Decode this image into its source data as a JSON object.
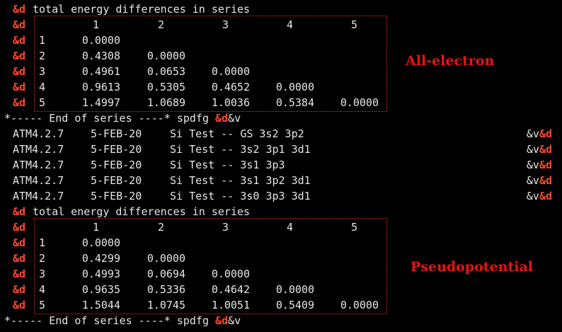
{
  "marker": "&d",
  "marker_v": "&v",
  "header_text": "total energy differences in series",
  "column_headers": [
    "1",
    "2",
    "3",
    "4",
    "5"
  ],
  "row_numbers": [
    "1",
    "2",
    "3",
    "4",
    "5"
  ],
  "all_electron": {
    "label": "All-electron",
    "rows": [
      [
        "0.0000"
      ],
      [
        "0.4308",
        "0.0000"
      ],
      [
        "0.4961",
        "0.0653",
        "0.0000"
      ],
      [
        "0.9613",
        "0.5305",
        "0.4652",
        "0.0000"
      ],
      [
        "1.4997",
        "1.0689",
        "1.0036",
        "0.5384",
        "0.0000"
      ]
    ]
  },
  "pseudopotential": {
    "label": "Pseudopotential",
    "rows": [
      [
        "0.0000"
      ],
      [
        "0.4299",
        "0.0000"
      ],
      [
        "0.4993",
        "0.0694",
        "0.0000"
      ],
      [
        "0.9635",
        "0.5336",
        "0.4642",
        "0.0000"
      ],
      [
        "1.5044",
        "1.0745",
        "1.0051",
        "0.5409",
        "0.0000"
      ]
    ]
  },
  "end_line": "*----- End of series ----* spdfg ",
  "atm_lines": [
    {
      "prog": "ATM4.2.7",
      "date": "5-FEB-20",
      "desc": "Si Test -- GS 3s2 3p2"
    },
    {
      "prog": "ATM4.2.7",
      "date": "5-FEB-20",
      "desc": "Si Test -- 3s2 3p1 3d1"
    },
    {
      "prog": "ATM4.2.7",
      "date": "5-FEB-20",
      "desc": "Si Test -- 3s1 3p3"
    },
    {
      "prog": "ATM4.2.7",
      "date": "5-FEB-20",
      "desc": "Si Test -- 3s1 3p2 3d1"
    },
    {
      "prog": "ATM4.2.7",
      "date": "5-FEB-20",
      "desc": "Si Test -- 3s0 3p3 3d1"
    }
  ],
  "colors": {
    "background": "#000000",
    "text": "#e6e6e6",
    "marker": "#ff4a2e",
    "annotation": "#ee1111"
  }
}
